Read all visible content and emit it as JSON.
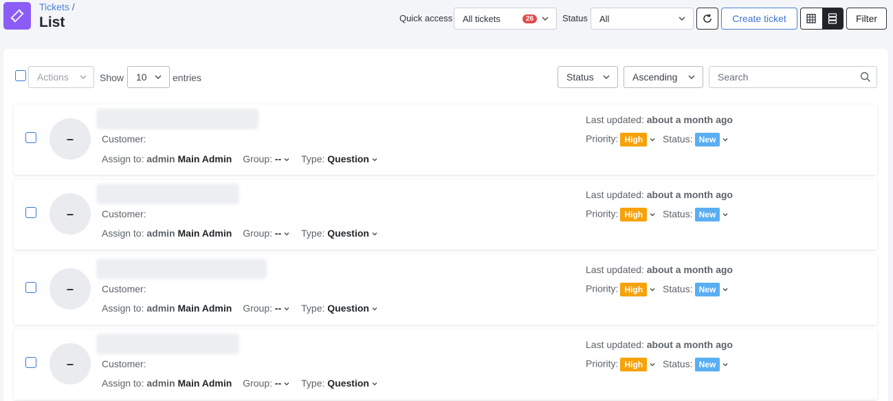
{
  "header": {
    "breadcrumb_parent": "Tickets",
    "breadcrumb_sep": "/",
    "title": "List",
    "quick_access_label": "Quick access",
    "quick_access_value": "All tickets",
    "quick_access_count": "26",
    "status_label": "Status",
    "status_value": "All",
    "create_ticket": "Create ticket",
    "filter": "Filter"
  },
  "toolbar": {
    "actions": "Actions",
    "show": "Show",
    "entries_value": "10",
    "entries": "entries",
    "sort_field": "Status",
    "sort_order": "Ascending",
    "search_placeholder": "Search"
  },
  "labels": {
    "customer": "Customer:",
    "assign_to": "Assign to:",
    "group": "Group:",
    "type": "Type:",
    "last_updated": "Last updated:",
    "priority": "Priority:",
    "status": "Status:"
  },
  "tickets": [
    {
      "avatar": "–",
      "assignee_login": "admin",
      "assignee_name": "Main Admin",
      "group": "--",
      "type": "Question",
      "updated": "about a month ago",
      "priority": "High",
      "status": "New"
    },
    {
      "avatar": "–",
      "assignee_login": "admin",
      "assignee_name": "Main Admin",
      "group": "--",
      "type": "Question",
      "updated": "about a month ago",
      "priority": "High",
      "status": "New"
    },
    {
      "avatar": "–",
      "assignee_login": "admin",
      "assignee_name": "Main Admin",
      "group": "--",
      "type": "Question",
      "updated": "about a month ago",
      "priority": "High",
      "status": "New"
    },
    {
      "avatar": "–",
      "assignee_login": "admin",
      "assignee_name": "Main Admin",
      "group": "--",
      "type": "Question",
      "updated": "about a month ago",
      "priority": "High",
      "status": "New"
    }
  ],
  "colors": {
    "accent": "#8b5cf6",
    "priority_high": "#f6a20a",
    "status_new": "#5aaef2",
    "badge": "#e24c4c"
  }
}
